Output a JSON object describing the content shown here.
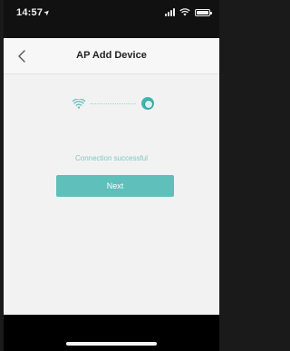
{
  "status_bar": {
    "time": "14:57",
    "icons": [
      "location-arrow-icon",
      "signal-icon",
      "wifi-icon",
      "battery-icon"
    ],
    "battery_level": 1.0
  },
  "nav": {
    "back_icon": "chevron-left-icon",
    "title": "AP Add Device"
  },
  "connection": {
    "left_icon": "wifi-icon",
    "right_icon": "router-icon",
    "status_text": "Connection successful",
    "accent_color": "#5fbfba"
  },
  "actions": {
    "next_label": "Next"
  }
}
